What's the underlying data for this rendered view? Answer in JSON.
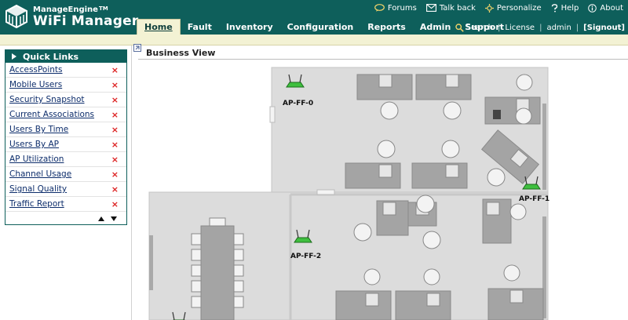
{
  "header": {
    "brand_top": "ManageEngine",
    "brand_tm": "TM",
    "brand_main": "WiFi Manager",
    "top_links": [
      {
        "label": "Forums",
        "icon": "chat-bubble-icon"
      },
      {
        "label": "Talk back",
        "icon": "envelope-icon"
      },
      {
        "label": "Personalize",
        "icon": "gear-icon"
      },
      {
        "label": "Help",
        "icon": "question-icon"
      },
      {
        "label": "About",
        "icon": "info-icon"
      }
    ],
    "nav_tabs": [
      "Home",
      "Fault",
      "Inventory",
      "Configuration",
      "Reports",
      "Admin",
      "Support"
    ],
    "active_tab": "Home",
    "search_label": "Search",
    "license_label": "License",
    "user_label": "admin",
    "signout_label": "[Signout]"
  },
  "sidebar": {
    "title": "Quick Links",
    "items": [
      {
        "label": "AccessPoints"
      },
      {
        "label": "Mobile Users"
      },
      {
        "label": "Security Snapshot"
      },
      {
        "label": "Current Associations"
      },
      {
        "label": "Users By Time"
      },
      {
        "label": "Users By AP"
      },
      {
        "label": "AP Utilization"
      },
      {
        "label": "Channel Usage"
      },
      {
        "label": "Signal Quality"
      },
      {
        "label": "Traffic Report"
      }
    ],
    "remove_glyph": "×"
  },
  "main": {
    "title": "Business View",
    "access_points": [
      {
        "label": "AP-FF-0"
      },
      {
        "label": "AP-FF-1"
      },
      {
        "label": "AP-FF-2"
      }
    ]
  },
  "colors": {
    "header_bg": "#0e5f5b",
    "tab_active_bg": "#f3f2d4",
    "link_color": "#0d2d6b",
    "remove_color": "#dd2222",
    "floor_bg": "#dcdcdc"
  }
}
